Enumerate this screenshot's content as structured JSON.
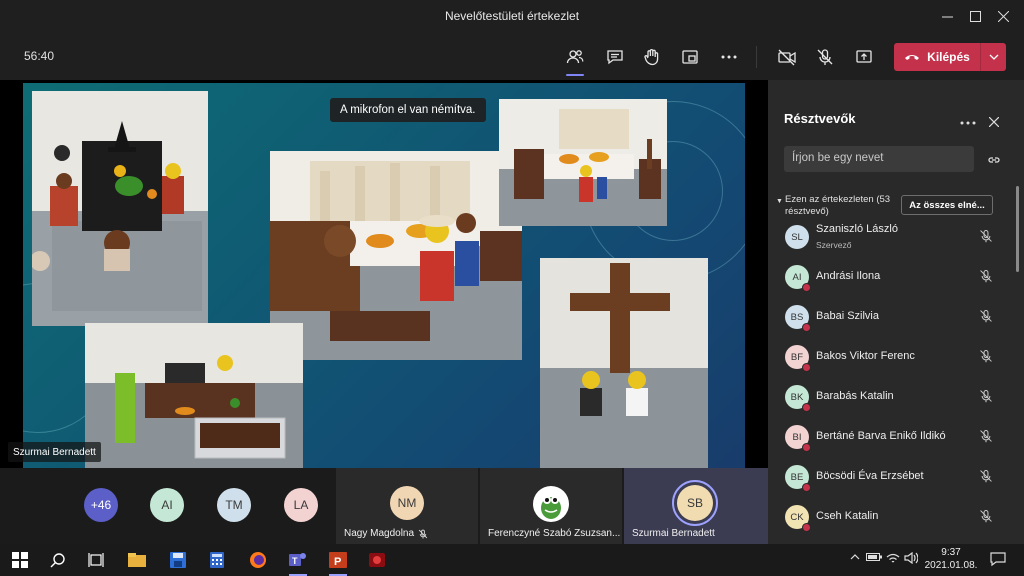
{
  "window": {
    "title": "Nevelőtestületi értekezlet",
    "controls": {
      "minimize": "minimize-icon",
      "maximize": "maximize-icon",
      "close": "close-icon"
    }
  },
  "toolbar": {
    "timer": "56:40",
    "buttons": [
      "people-icon",
      "chat-icon",
      "raise-hand-icon",
      "breakout-rooms-icon",
      "more-options-icon",
      "camera-off-icon",
      "mic-off-icon",
      "share-screen-icon"
    ],
    "leave_label": "Kilépés"
  },
  "stage": {
    "toast": "A mikrofon el van némítva.",
    "presenter_name": "Szurmai Bernadett"
  },
  "strip": {
    "overflow_count": "+46",
    "avatars": [
      {
        "initials": "AI",
        "color": "#c5e8d6"
      },
      {
        "initials": "TM",
        "color": "#cfe0ec"
      },
      {
        "initials": "LA",
        "color": "#f3d2d2"
      }
    ],
    "tiles": [
      {
        "initials": "NM",
        "name": "Nagy Magdolna",
        "color": "#f1d6b4"
      },
      {
        "name": "Ferenczyné Szabó Zsuzsan..."
      },
      {
        "initials": "SB",
        "name": "Szurmai Bernadett",
        "color": "#f1dcb2"
      }
    ]
  },
  "panel": {
    "title": "Résztvevők",
    "search_placeholder": "Írjon be egy nevet",
    "section_label": "Ezen az értekezleten (53 résztvevő)",
    "mute_all_label": "Az összes elné...",
    "participants": [
      {
        "initials": "SL",
        "name": "Szaniszló László",
        "role": "Szervező",
        "color": "#cfe0ec"
      },
      {
        "initials": "AI",
        "name": "Andrási Ilona",
        "color": "#c5e8d6"
      },
      {
        "initials": "BS",
        "name": "Babai Szilvia",
        "color": "#cfe0ec"
      },
      {
        "initials": "BF",
        "name": "Bakos Viktor Ferenc",
        "color": "#f3d2d2"
      },
      {
        "initials": "BK",
        "name": "Barabás Katalin",
        "color": "#c5e8d6"
      },
      {
        "initials": "BI",
        "name": "Bertáné Barva Enikő Ildikó",
        "color": "#f3d2d2"
      },
      {
        "initials": "BE",
        "name": "Böcsödi Éva Erzsébet",
        "color": "#c5e8d6"
      },
      {
        "initials": "CK",
        "name": "Cseh Katalin",
        "color": "#f1e3b2"
      }
    ]
  },
  "taskbar": {
    "apps": [
      "windows-start-icon",
      "search-icon",
      "task-view-icon",
      "file-explorer-icon",
      "save-app-icon",
      "calculator-icon",
      "firefox-icon",
      "teams-icon",
      "powerpoint-icon",
      "app-icon"
    ],
    "time": "9:37",
    "date": "2021.01.08."
  }
}
